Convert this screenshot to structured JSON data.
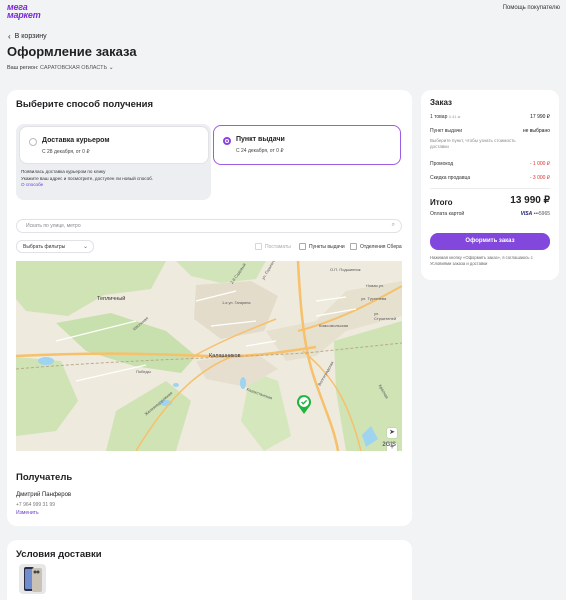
{
  "header": {
    "logo_top": "мега",
    "logo_bottom": "маркет",
    "help": "Помощь покупателю"
  },
  "nav": {
    "back_label": "В корзину"
  },
  "page": {
    "title": "Оформление заказа",
    "region_label": "Ваш регион:",
    "region_value": "САРАТОВСКАЯ ОБЛАСТЬ"
  },
  "delivery": {
    "title": "Выберите способ получения",
    "options": [
      {
        "label": "Доставка курьером",
        "sub": "С 28 декабря, от 0 ₽",
        "selected": false
      },
      {
        "label": "Пункт выдачи",
        "sub": "С 24 декабря, от 0 ₽",
        "selected": true
      }
    ],
    "notice_title": "Появилась доставка курьером по клику",
    "notice_text": "Укажите ваш адрес и посмотрите, доступен ли новый способ.",
    "notice_link": "О способе",
    "search_placeholder": "Искать по улице, метро",
    "filter_select": "Выбрать фильтры",
    "filters": [
      {
        "label": "Постаматы",
        "dim": true
      },
      {
        "label": "Пункты выдачи",
        "dim": false
      },
      {
        "label": "Отделения Сбера",
        "dim": false
      }
    ]
  },
  "map": {
    "labels": {
      "teplichny": "Тепличный",
      "kalashnikov": "Калашников",
      "kaz": "Казахстанская",
      "gorkogo": "ул. Горького",
      "odn": "2-й Садовый",
      "shkol": "Школьная",
      "zhel": "Железнодорожная",
      "volg": "Волгоградская",
      "pob": "Победы",
      "kom": "Комсомольская",
      "gagarina": "1-я ул. Гагарина",
      "podg": "О.П. Подшипник",
      "nov": "Новая ул.",
      "tulg": "ул. Тургенева",
      "str": "ул. Строителей",
      "kras": "Красная"
    },
    "brand": "2GIS"
  },
  "recipient": {
    "title": "Получатель",
    "name": "Дмитрий Панферов",
    "phone": "+7 964 999 31 99",
    "edit": "Изменить"
  },
  "terms": {
    "title": "Условия доставки"
  },
  "summary": {
    "title": "Заказ",
    "items_label": "1 товар",
    "items_weight": "0.41 кг",
    "items_value": "17 990 ₽",
    "pickup_label": "Пункт выдачи",
    "pickup_value": "не выбрано",
    "pickup_hint": "Выберите пункт, чтобы узнать стоимость доставки",
    "promo_label": "Промокод",
    "promo_value": "- 1 000 ₽",
    "sale_label": "Скидка продавца",
    "sale_value": "- 3 000 ₽",
    "total_label": "Итого",
    "total_value": "13 990 ₽",
    "pay_label": "Оплата картой",
    "pay_brand": "VISA",
    "pay_card": "•••5965",
    "button": "Оформить заказ",
    "legal": "Нажимая кнопку «Оформить заказ», я соглашаюсь с Условиями заказа и доставки"
  },
  "colors": {
    "accent": "#8247dd",
    "discount": "#d8332f",
    "map_pin": "#1fb53c"
  }
}
